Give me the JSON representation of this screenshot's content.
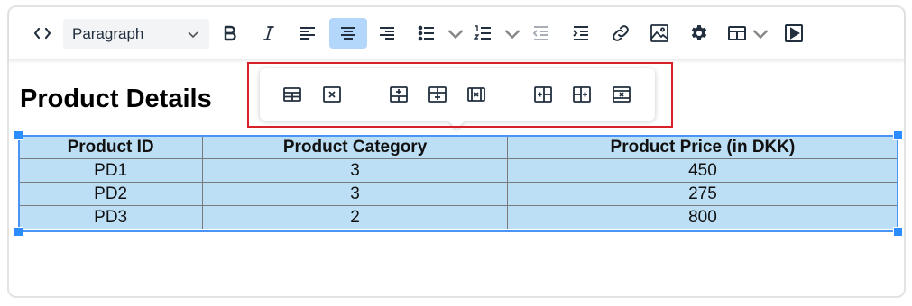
{
  "toolbar": {
    "block_format": "Paragraph",
    "items": [
      {
        "name": "source-code-icon"
      },
      {
        "name": "bold-icon"
      },
      {
        "name": "italic-icon"
      },
      {
        "name": "align-left-icon"
      },
      {
        "name": "align-center-icon",
        "active": true
      },
      {
        "name": "align-right-icon"
      },
      {
        "name": "bullet-list-icon"
      },
      {
        "name": "numbered-list-icon"
      },
      {
        "name": "outdent-icon"
      },
      {
        "name": "indent-icon"
      },
      {
        "name": "link-icon"
      },
      {
        "name": "image-icon"
      },
      {
        "name": "settings-gear-icon"
      },
      {
        "name": "table-icon"
      },
      {
        "name": "media-play-icon"
      }
    ]
  },
  "content": {
    "heading": "Product Details",
    "table": {
      "headers": [
        "Product ID",
        "Product Category",
        "Product Price (in DKK)"
      ],
      "rows": [
        [
          "PD1",
          "3",
          "450"
        ],
        [
          "PD2",
          "3",
          "275"
        ],
        [
          "PD3",
          "2",
          "800"
        ]
      ]
    }
  },
  "table_context_toolbar": {
    "buttons": [
      "table-properties-icon",
      "delete-table-icon",
      "insert-row-before-icon",
      "insert-row-after-icon",
      "delete-row-icon",
      "insert-column-before-icon",
      "insert-column-after-icon",
      "delete-column-icon"
    ]
  },
  "colors": {
    "accent": "#b3d6fb",
    "table_fill": "#bcdff5",
    "selection": "#4a94f6",
    "highlight": "#d92027"
  }
}
